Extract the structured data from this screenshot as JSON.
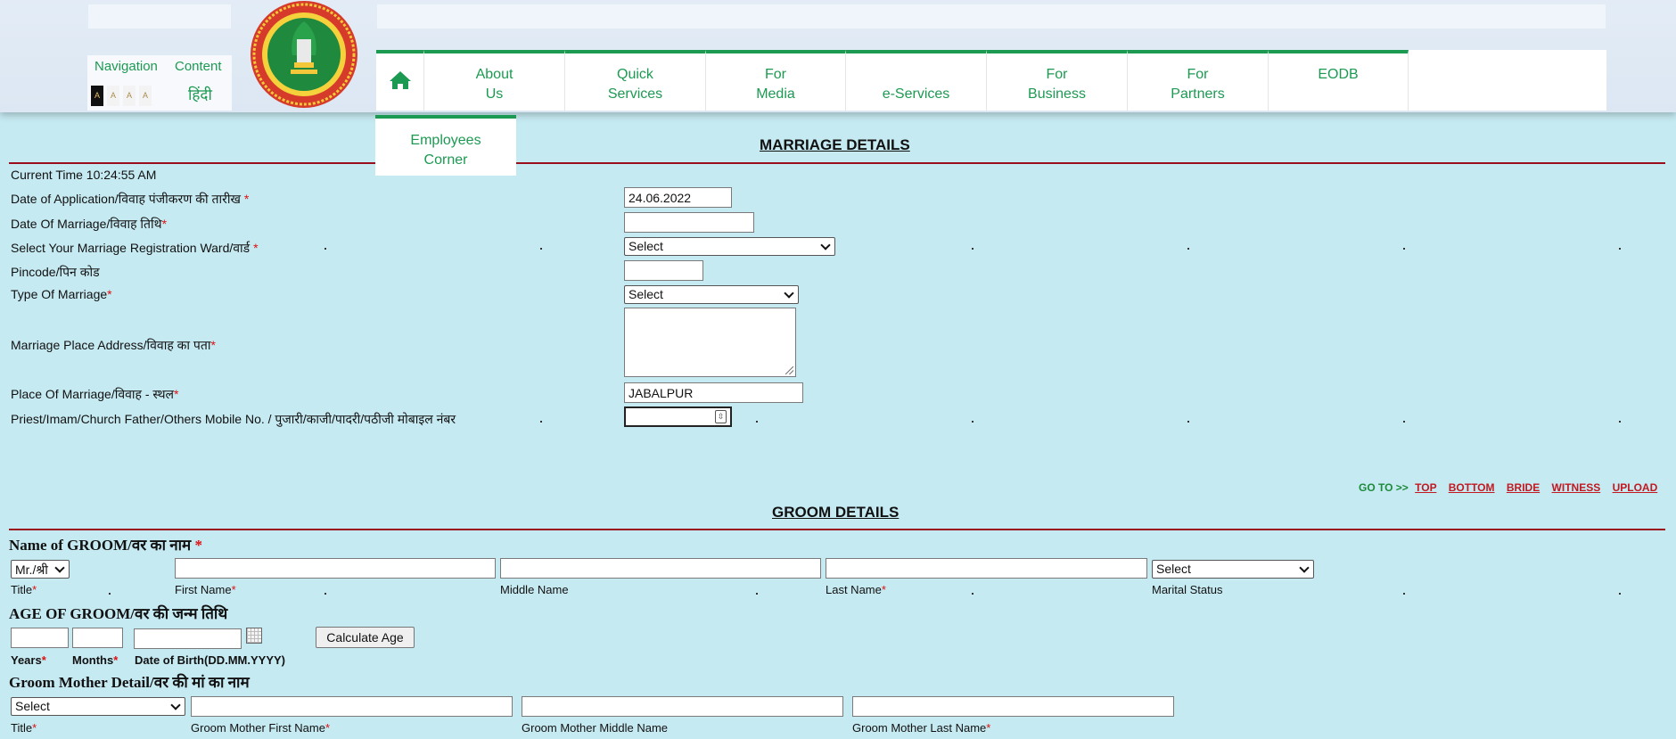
{
  "header": {
    "nav_label": "Navigation",
    "content_label": "Content",
    "hindi_label": "हिंदी",
    "font_sizes": [
      "A",
      "A",
      "A",
      "A"
    ]
  },
  "nav": {
    "home_icon": "home-icon",
    "items": [
      {
        "label": "About\nUs"
      },
      {
        "label": "Quick\nServices"
      },
      {
        "label": "For\nMedia"
      },
      {
        "label": "\ne-Services"
      },
      {
        "label": "For\nBusiness"
      },
      {
        "label": "For\nPartners"
      },
      {
        "label": "EODB"
      }
    ],
    "dropdown_label": "Employees\nCorner"
  },
  "marriage": {
    "title": "MARRIAGE DETAILS",
    "current_time": "Current Time 10:24:55 AM",
    "application_date_label": "Date of Application/विवाह पंजीकरण की तारीख",
    "application_date_value": "24.06.2022",
    "marriage_date_label": "Date Of Marriage/विवाह तिथि",
    "ward_label": "Select Your Marriage Registration Ward/वार्ड",
    "ward_value": "Select",
    "pincode_label": "Pincode/पिन कोड",
    "type_label": "Type Of Marriage",
    "type_value": "Select",
    "address_label": "Marriage Place Address/विवाह का पता",
    "place_label": "Place Of Marriage/विवाह - स्थल",
    "place_value": "JABALPUR",
    "priest_label": "Priest/Imam/Church Father/Others Mobile No. / पुजारी/काजी/पादरी/पठीजी मोबाइल नंबर",
    "required_mark": "*"
  },
  "goto": {
    "prefix": "GO TO >>",
    "links": [
      "TOP",
      "BOTTOM",
      "BRIDE",
      "WITNESS",
      "UPLOAD"
    ]
  },
  "groom": {
    "title": "GROOM DETAILS",
    "name_heading": "Name of GROOM/वर का नाम",
    "title_value": "Mr./श्री",
    "marital_value": "Select",
    "title_label": "Title",
    "first_name_label": "First Name",
    "middle_name_label": "Middle Name",
    "last_name_label": "Last Name",
    "marital_label": "Marital Status",
    "age_heading": "AGE OF GROOM/वर की जन्म तिथि",
    "years_label": "Years",
    "months_label": "Months",
    "dob_label": "Date of Birth(DD.MM.YYYY)",
    "calc_button": "Calculate Age",
    "mother_heading": "Groom Mother Detail/वर की मां का नाम",
    "mother_title_value": "Select",
    "mother_title_label": "Title",
    "mother_first_label": "Groom Mother First Name",
    "mother_middle_label": "Groom Mother Middle Name",
    "mother_last_label": "Groom Mother Last Name"
  },
  "colors": {
    "accent_green": "#1c9a52",
    "rule_red": "#9a0f1b",
    "page_bg": "#c6eaf2"
  }
}
